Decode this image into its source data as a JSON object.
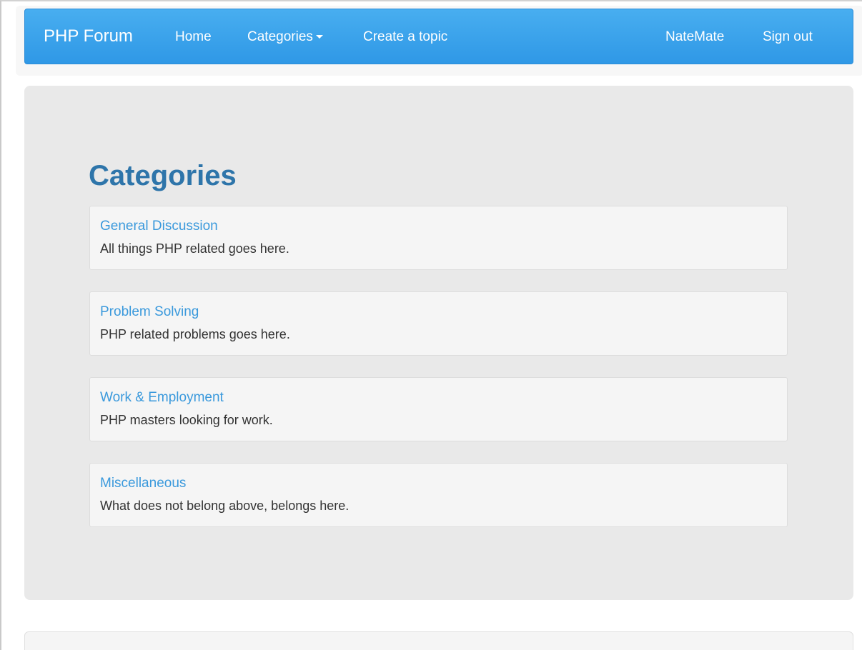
{
  "navbar": {
    "brand": "PHP Forum",
    "items": [
      {
        "label": "Home"
      },
      {
        "label": "Categories"
      },
      {
        "label": "Create a topic"
      }
    ],
    "right_items": [
      {
        "label": "NateMate"
      },
      {
        "label": "Sign out"
      }
    ],
    "color": "#3aa3eb"
  },
  "main": {
    "title": "Categories",
    "title_color": "#2e75aa",
    "link_color": "#3a99dc",
    "categories": [
      {
        "name": "General Discussion",
        "description": "All things PHP related goes here."
      },
      {
        "name": "Problem Solving",
        "description": "PHP related problems goes here."
      },
      {
        "name": "Work & Employment",
        "description": "PHP masters looking for work."
      },
      {
        "name": "Miscellaneous",
        "description": "What does not belong above, belongs here."
      }
    ]
  }
}
